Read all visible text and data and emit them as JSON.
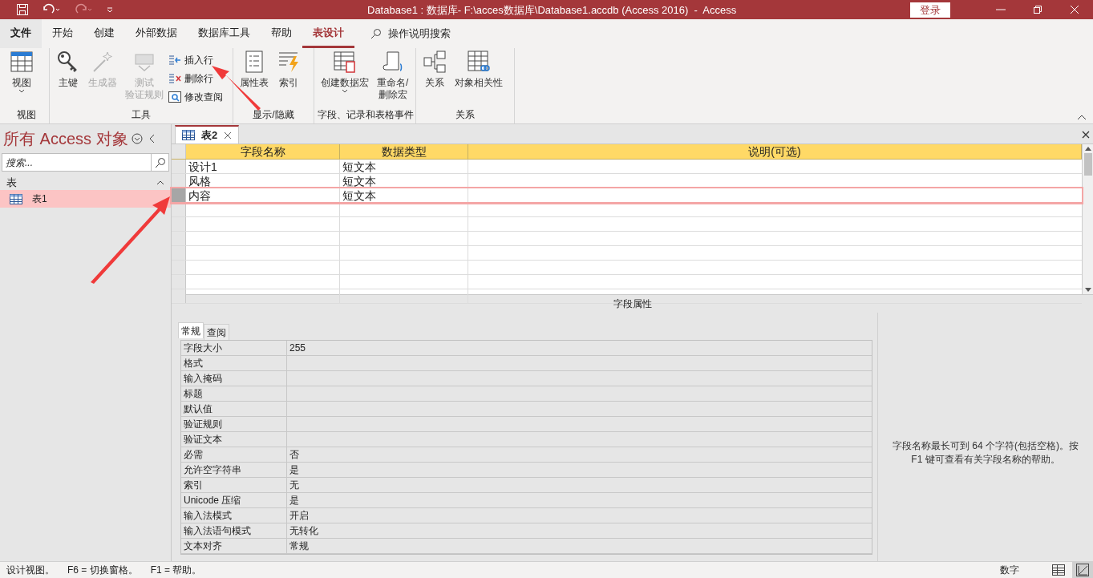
{
  "window": {
    "title": "Database1 : 数据库- F:\\acces数据库\\Database1.accdb (Access 2016)  -  Access",
    "sign_in": "登录"
  },
  "menu_tabs": [
    {
      "label": "文件",
      "selected": false,
      "bold": true
    },
    {
      "label": "开始",
      "selected": false,
      "bold": false
    },
    {
      "label": "创建",
      "selected": false,
      "bold": false
    },
    {
      "label": "外部数据",
      "selected": false,
      "bold": false
    },
    {
      "label": "数据库工具",
      "selected": false,
      "bold": false
    },
    {
      "label": "帮助",
      "selected": false,
      "bold": false
    },
    {
      "label": "表设计",
      "selected": true,
      "bold": false
    }
  ],
  "tell_me": "操作说明搜索",
  "ribbon_groups": [
    {
      "label": "视图",
      "buttons": [
        {
          "lines": [
            "视图"
          ],
          "disabled": false,
          "dropdown": true
        }
      ]
    },
    {
      "label": "工具",
      "buttons": [
        {
          "lines": [
            "主键"
          ],
          "disabled": false,
          "dropdown": false
        },
        {
          "lines": [
            "生成器"
          ],
          "disabled": true,
          "dropdown": false
        },
        {
          "lines": [
            "测试",
            "验证规则"
          ],
          "disabled": true,
          "dropdown": false
        }
      ],
      "small_buttons": [
        {
          "label": "插入行"
        },
        {
          "label": "删除行"
        },
        {
          "label": "修改查阅"
        }
      ]
    },
    {
      "label": "显示/隐藏",
      "buttons": [
        {
          "lines": [
            "属性表"
          ],
          "disabled": false,
          "dropdown": false
        },
        {
          "lines": [
            "索引"
          ],
          "disabled": false,
          "dropdown": false
        }
      ]
    },
    {
      "label": "字段、记录和表格事件",
      "buttons": [
        {
          "lines": [
            "创建数据宏"
          ],
          "disabled": false,
          "dropdown": true
        },
        {
          "lines": [
            "重命名/",
            "删除宏"
          ],
          "disabled": false,
          "dropdown": false
        }
      ]
    },
    {
      "label": "关系",
      "buttons": [
        {
          "lines": [
            "关系"
          ],
          "disabled": false,
          "dropdown": false
        },
        {
          "lines": [
            "对象相关性"
          ],
          "disabled": false,
          "dropdown": false
        }
      ]
    }
  ],
  "nav_pane": {
    "title": "所有 Access 对象",
    "search": {
      "placeholder": "搜索..."
    },
    "groups": [
      {
        "label": "表",
        "expanded": true,
        "items": [
          {
            "label": "表1",
            "selected": true
          }
        ]
      }
    ]
  },
  "document_tabs": [
    {
      "label": "表2",
      "selected": true
    }
  ],
  "design_grid": {
    "columns": [
      "字段名称",
      "数据类型",
      "说明(可选)"
    ],
    "rows": [
      {
        "field_name": "设计1",
        "data_type": "短文本",
        "selected": false
      },
      {
        "field_name": "风格",
        "data_type": "短文本",
        "selected": false
      },
      {
        "field_name": "内容",
        "data_type": "短文本",
        "selected": true
      }
    ]
  },
  "field_properties": {
    "title": "字段属性",
    "tabs": [
      {
        "label": "常规",
        "selected": true
      },
      {
        "label": "查阅",
        "selected": false
      }
    ],
    "rows": [
      {
        "name": "字段大小",
        "value": "255"
      },
      {
        "name": "格式"
      },
      {
        "name": "输入掩码"
      },
      {
        "name": "标题"
      },
      {
        "name": "默认值"
      },
      {
        "name": "验证规则"
      },
      {
        "name": "验证文本"
      },
      {
        "name": "必需",
        "value": "否"
      },
      {
        "name": "允许空字符串",
        "value": "是"
      },
      {
        "name": "索引",
        "value": "无"
      },
      {
        "name": "Unicode 压缩",
        "value": "是"
      },
      {
        "name": "输入法模式",
        "value": "开启"
      },
      {
        "name": "输入法语句模式",
        "value": "无转化"
      },
      {
        "name": "文本对齐",
        "value": "常规"
      }
    ],
    "help": "字段名称最长可到 64 个字符(包括空格)。按 F1 键可查看有关字段名称的帮助。"
  },
  "status_bar": {
    "items": [
      "设计视图。",
      "F6 = 切换窗格。",
      "F1 = 帮助。"
    ],
    "num_lock": "数字"
  }
}
